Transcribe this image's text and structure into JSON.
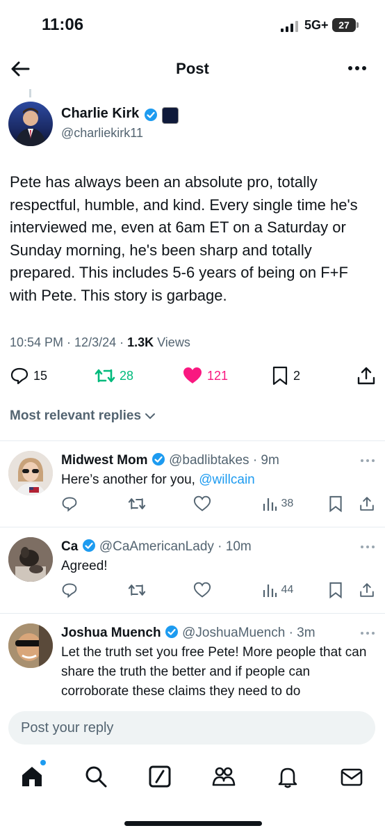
{
  "status": {
    "time": "11:06",
    "network": "5G+",
    "battery": "27"
  },
  "header": {
    "title": "Post"
  },
  "post": {
    "author": "Charlie Kirk",
    "handle": "@charliekirk11",
    "text": "Pete has always been an absolute pro, totally respectful, humble, and kind. Every single time he's interviewed me, even at 6am ET on a Saturday or Sunday morning, he's been sharp and totally prepared. This includes 5-6 years of being on F+F with Pete. This story is garbage.",
    "timestamp": "10:54 PM · 12/3/24 · ",
    "views_count": "1.3K",
    "views_label": " Views",
    "replies": "15",
    "reposts": "28",
    "likes": "121",
    "bookmarks": "2"
  },
  "sort_label": "Most relevant replies",
  "replies": [
    {
      "name": "Midwest Mom",
      "handle": "@badlibtakes · 9m",
      "text": "Here’s another for you, ",
      "mention": "@willcain",
      "views": "38"
    },
    {
      "name": "Ca",
      "handle": "@CaAmericanLady · 10m",
      "text": "Agreed!",
      "views": "44"
    },
    {
      "name": "Joshua Muench",
      "handle": "@JoshuaMuench · 3m",
      "text": "Let the truth set you free Pete! More people that can share the truth the better and if people can corroborate these claims they need to do"
    }
  ],
  "compose": {
    "placeholder": "Post your reply"
  },
  "colors": {
    "accent": "#1d9bf0",
    "like": "#f91880",
    "repost": "#00ba7c"
  }
}
